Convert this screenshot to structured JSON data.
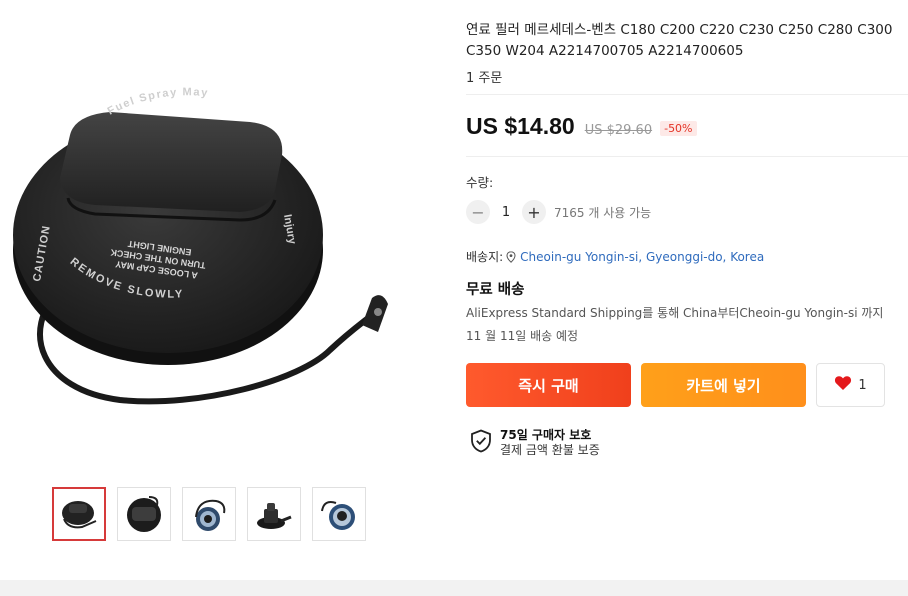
{
  "product": {
    "title": "연료 필러 메르세데스-벤츠 C180 C200 C220 C230 C250 C280 C300 C350 W204 A2214700705 A2214700605",
    "orders": "1 주문",
    "price_now": "US $14.80",
    "price_old": "US $29.60",
    "discount": "-50%"
  },
  "image": {
    "cap_top_text": "Fuel Spray May",
    "cap_side_left": "CAUTION",
    "cap_side_right": "Injury",
    "cap_bottom_text": "REMOVE SLOWLY",
    "cap_mid_1": "A LOOSE CAP MAY",
    "cap_mid_2": "TURN ON THE CHECK",
    "cap_mid_3": "ENGINE LIGHT"
  },
  "thumbnails": [
    "thumb-1",
    "thumb-2",
    "thumb-3",
    "thumb-4",
    "thumb-5"
  ],
  "quantity": {
    "label": "수량:",
    "minus": "−",
    "value": "1",
    "plus": "+",
    "available": "7165 개 사용 가능"
  },
  "shipping": {
    "to_label": "배송지:",
    "location": "Cheoin-gu Yongin-si, Gyeonggi-do, Korea",
    "free": "무료 배송",
    "detail": "AliExpress Standard Shipping를 통해 China부터Cheoin-gu Yongin-si 까지",
    "date": "11 월 11일 배송 예정"
  },
  "actions": {
    "buy_now": "즉시 구매",
    "add_cart": "카트에 넣기",
    "wish_count": "1"
  },
  "protection": {
    "title": "75일 구매자 보호",
    "sub": "결제 금액 환불 보증"
  },
  "colors": {
    "accent": "#f0401c",
    "cart": "#ff9a1b",
    "link": "#2f6bbd",
    "heart": "#e4191c"
  }
}
